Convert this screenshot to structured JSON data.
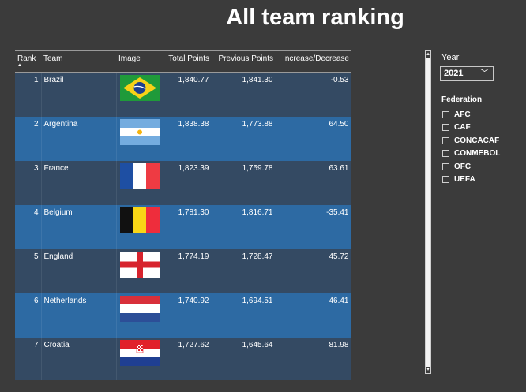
{
  "title": "All team ranking",
  "table": {
    "columns": [
      "Rank",
      "Team",
      "Image",
      "Total Points",
      "Previous Points",
      "Increase/Decrease"
    ],
    "rows": [
      {
        "rank": "1",
        "team": "Brazil",
        "flag": "brazil-flag",
        "total": "1,840.77",
        "previous": "1,841.30",
        "change": "-0.53"
      },
      {
        "rank": "2",
        "team": "Argentina",
        "flag": "argentina-flag",
        "total": "1,838.38",
        "previous": "1,773.88",
        "change": "64.50"
      },
      {
        "rank": "3",
        "team": "France",
        "flag": "france-flag",
        "total": "1,823.39",
        "previous": "1,759.78",
        "change": "63.61"
      },
      {
        "rank": "4",
        "team": "Belgium",
        "flag": "belgium-flag",
        "total": "1,781.30",
        "previous": "1,816.71",
        "change": "-35.41"
      },
      {
        "rank": "5",
        "team": "England",
        "flag": "england-flag",
        "total": "1,774.19",
        "previous": "1,728.47",
        "change": "45.72"
      },
      {
        "rank": "6",
        "team": "Netherlands",
        "flag": "netherlands-flag",
        "total": "1,740.92",
        "previous": "1,694.51",
        "change": "46.41"
      },
      {
        "rank": "7",
        "team": "Croatia",
        "flag": "croatia-flag",
        "total": "1,727.62",
        "previous": "1,645.64",
        "change": "81.98"
      }
    ],
    "sort_icon": "sort-ascending-caret"
  },
  "filters": {
    "year_label": "Year",
    "year_value": "2021",
    "federation_label": "Federation",
    "federations": [
      "AFC",
      "CAF",
      "CONCACAF",
      "CONMEBOL",
      "OFC",
      "UEFA"
    ]
  },
  "colors": {
    "background": "#3b3b3b",
    "row_odd": "#344a63",
    "row_even": "#2d6aa3"
  }
}
